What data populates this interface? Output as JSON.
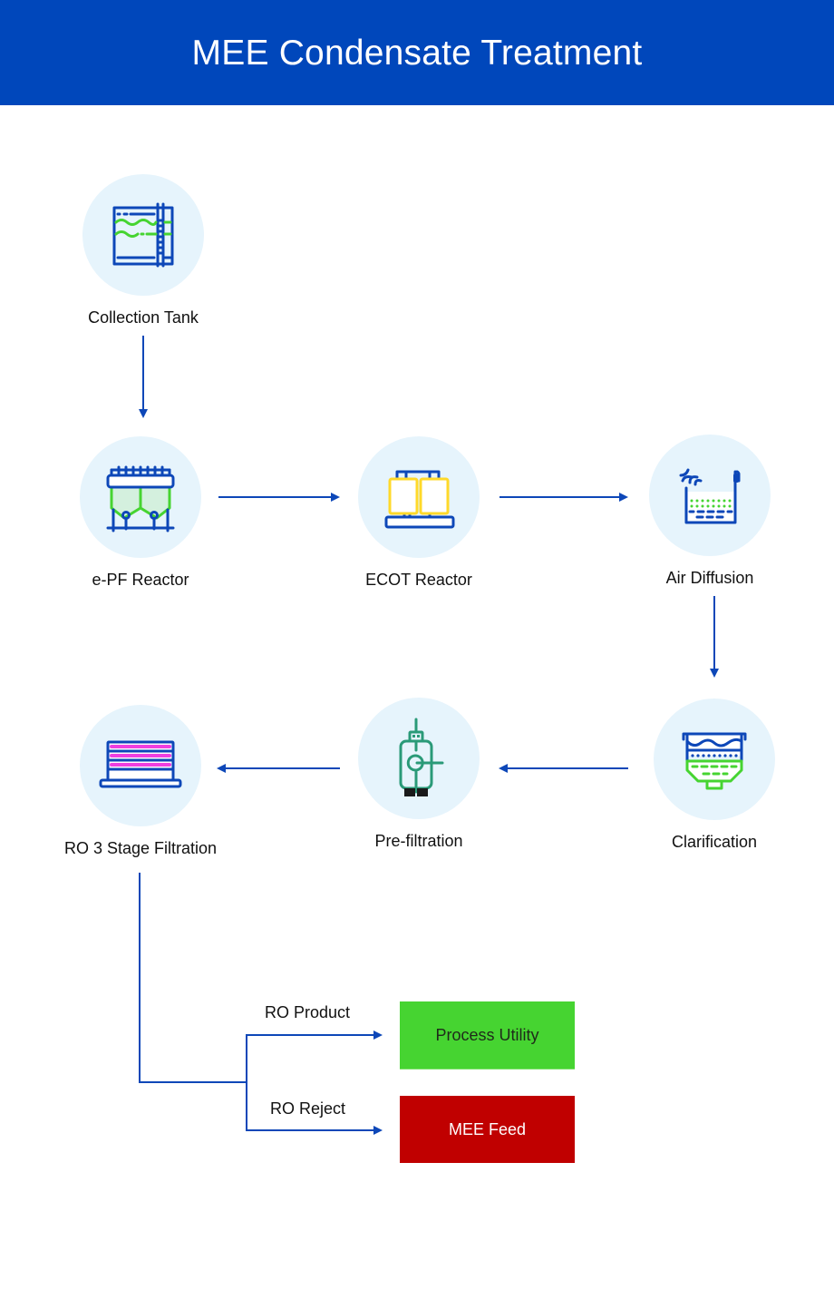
{
  "header": {
    "title": "MEE Condensate Treatment"
  },
  "colors": {
    "brand_blue": "#0047bb",
    "icon_blue": "#0d47b8",
    "circle_bg": "#e6f4fc",
    "green": "#46d431",
    "teal": "#2a9a78",
    "yellow": "#ffd92a",
    "magenta": "#ef3fe0",
    "reject_red": "#c00000"
  },
  "steps": [
    {
      "id": "collection-tank",
      "label": "Collection Tank",
      "icon": "tank-icon"
    },
    {
      "id": "epf-reactor",
      "label": "e-PF Reactor",
      "icon": "reactor-silo-icon"
    },
    {
      "id": "ecot-reactor",
      "label": "ECOT Reactor",
      "icon": "twin-reactor-icon"
    },
    {
      "id": "air-diffusion",
      "label": "Air Diffusion",
      "icon": "aeration-tank-icon"
    },
    {
      "id": "clarification",
      "label": "Clarification",
      "icon": "clarifier-icon"
    },
    {
      "id": "pre-filtration",
      "label": "Pre-filtration",
      "icon": "cartridge-filter-icon"
    },
    {
      "id": "ro-filtration",
      "label": "RO 3 Stage Filtration",
      "icon": "ro-membrane-stack-icon"
    }
  ],
  "outputs": {
    "product": {
      "flow_label": "RO Product",
      "destination": "Process Utility"
    },
    "reject": {
      "flow_label": "RO Reject",
      "destination": "MEE Feed"
    }
  }
}
